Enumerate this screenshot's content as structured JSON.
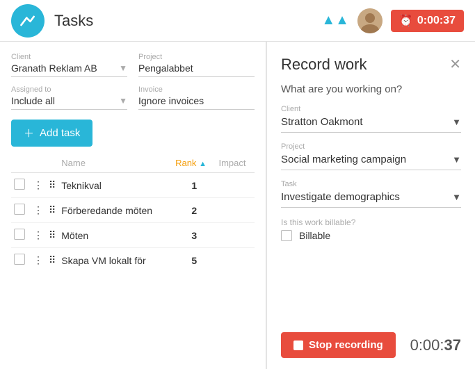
{
  "header": {
    "title": "Tasks",
    "timer_display": "0:00:",
    "timer_seconds": "37",
    "timer_full": "0:00:37"
  },
  "filters": {
    "client_label": "Client",
    "client_value": "Granath Reklam AB",
    "project_label": "Project",
    "project_value": "Pengalabbet",
    "assigned_label": "Assigned to",
    "assigned_value": "Include all",
    "invoice_label": "Invoice",
    "invoice_value": "Ignore invoices"
  },
  "add_task_label": "+ Add task",
  "table": {
    "col_name": "Name",
    "col_rank": "Rank",
    "col_impact": "Impact",
    "rows": [
      {
        "name": "Teknikval",
        "rank": "1",
        "rank_colored": true,
        "impact": ""
      },
      {
        "name": "Förberedande möten",
        "rank": "2",
        "rank_colored": false,
        "impact": ""
      },
      {
        "name": "Möten",
        "rank": "3",
        "rank_colored": false,
        "impact": ""
      },
      {
        "name": "Skapa VM lokalt för",
        "rank": "5",
        "rank_colored": false,
        "impact": ""
      }
    ]
  },
  "record_panel": {
    "title": "Record work",
    "working_on_label": "What are you working on?",
    "client_label": "Client",
    "client_value": "Stratton Oakmont",
    "project_label": "Project",
    "project_value": "Social marketing campaign",
    "task_label": "Task",
    "task_value": "Investigate demographics",
    "billable_section_label": "Is this work billable?",
    "billable_checkbox_label": "Billable",
    "stop_button_label": "Stop recording",
    "timer_prefix": "0:00:",
    "timer_seconds": "37"
  }
}
